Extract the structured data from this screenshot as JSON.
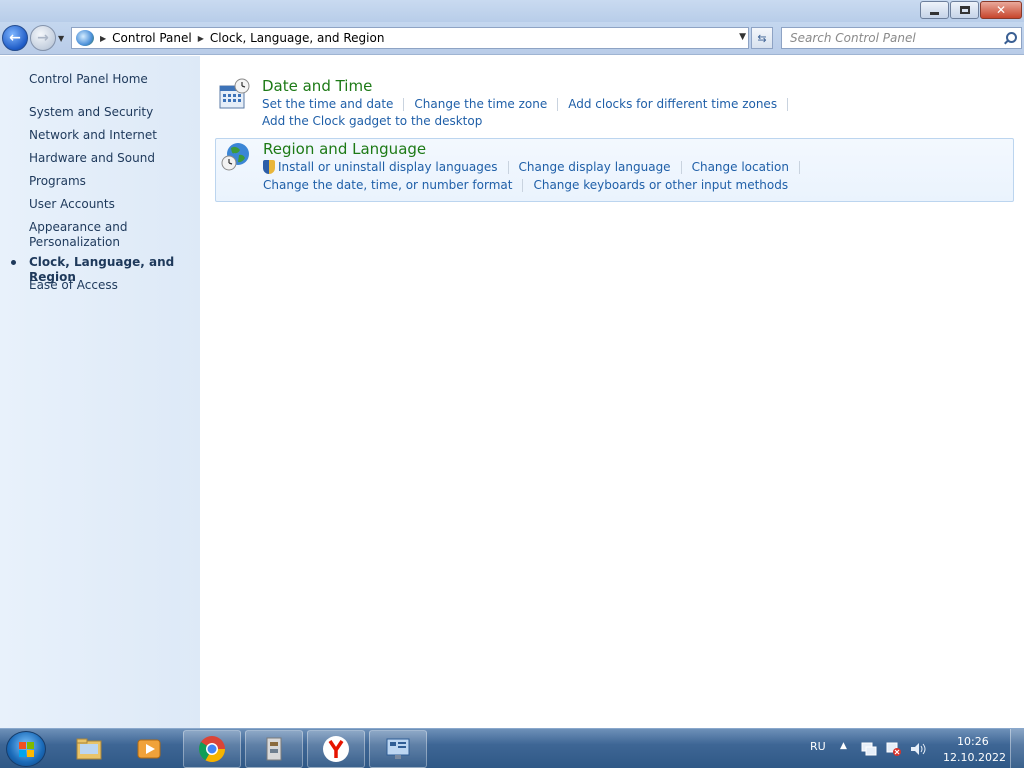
{
  "navigation": {
    "breadcrumbs": [
      "Control Panel",
      "Clock, Language, and Region"
    ],
    "search_placeholder": "Search Control Panel"
  },
  "sidebar": {
    "home": "Control Panel Home",
    "items": [
      {
        "label": "System and Security"
      },
      {
        "label": "Network and Internet"
      },
      {
        "label": "Hardware and Sound"
      },
      {
        "label": "Programs"
      },
      {
        "label": "User Accounts"
      },
      {
        "label": "Appearance and Personalization"
      },
      {
        "label": "Clock, Language, and Region",
        "active": true
      },
      {
        "label": "Ease of Access"
      }
    ]
  },
  "categories": [
    {
      "title": "Date and Time",
      "icon": "calendar-clock-icon",
      "links_row1": [
        "Set the time and date",
        "Change the time zone",
        "Add clocks for different time zones"
      ],
      "links_row2": [
        "Add the Clock gadget to the desktop"
      ]
    },
    {
      "title": "Region and Language",
      "icon": "globe-clock-icon",
      "links_row1": [
        "Install or uninstall display languages",
        "Change display language",
        "Change location"
      ],
      "links_row2": [
        "Change the date, time, or number format",
        "Change keyboards or other input methods"
      ]
    }
  ],
  "taskbar": {
    "apps": [
      {
        "name": "explorer",
        "icon": "folder-icon",
        "pinned": false
      },
      {
        "name": "media-player",
        "icon": "media-player-icon",
        "pinned": false
      },
      {
        "name": "chrome",
        "icon": "chrome-icon",
        "pinned": true
      },
      {
        "name": "archive",
        "icon": "archive-icon",
        "pinned": true
      },
      {
        "name": "yandex",
        "icon": "yandex-icon",
        "pinned": true
      },
      {
        "name": "control-panel",
        "icon": "control-panel-icon",
        "pinned": true
      }
    ],
    "language": "RU",
    "time": "10:26",
    "date": "12.10.2022"
  },
  "colors": {
    "link": "#1f5fa8",
    "category_title": "#1d7a16",
    "sidebar_text": "#1e395b"
  }
}
